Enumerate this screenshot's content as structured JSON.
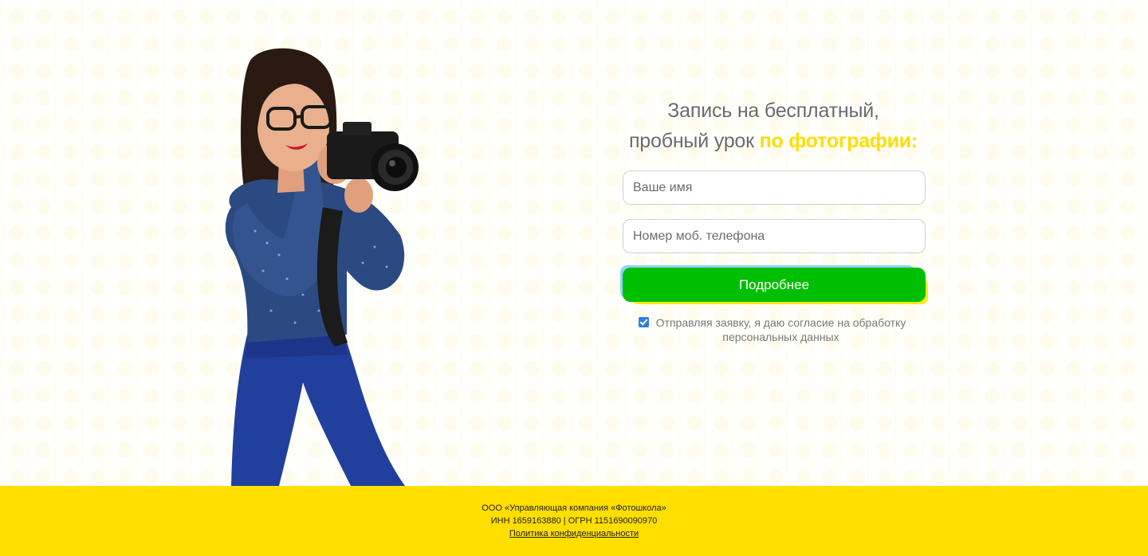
{
  "hero": {
    "title_line1": "Запись на бесплатный,",
    "title_line2_plain": "пробный урок ",
    "title_line2_accent": "по фотографии:"
  },
  "form": {
    "name_placeholder": "Ваше имя",
    "phone_placeholder": "Номер моб. телефона",
    "submit_label": "Подробнее",
    "consent_checked": true,
    "consent_text": "Отправляя заявку, я даю согласие на обработку персональных данных"
  },
  "footer": {
    "company": "ООО «Управляющая компания «Фотошкола»",
    "registration": "ИНН 1659163880 | ОГРН 1151690090970",
    "privacy_link": "Политика конфиденциальности"
  },
  "colors": {
    "accent_yellow": "#ffdd00",
    "button_green": "#00bf00",
    "footer_yellow": "#ffde00"
  }
}
